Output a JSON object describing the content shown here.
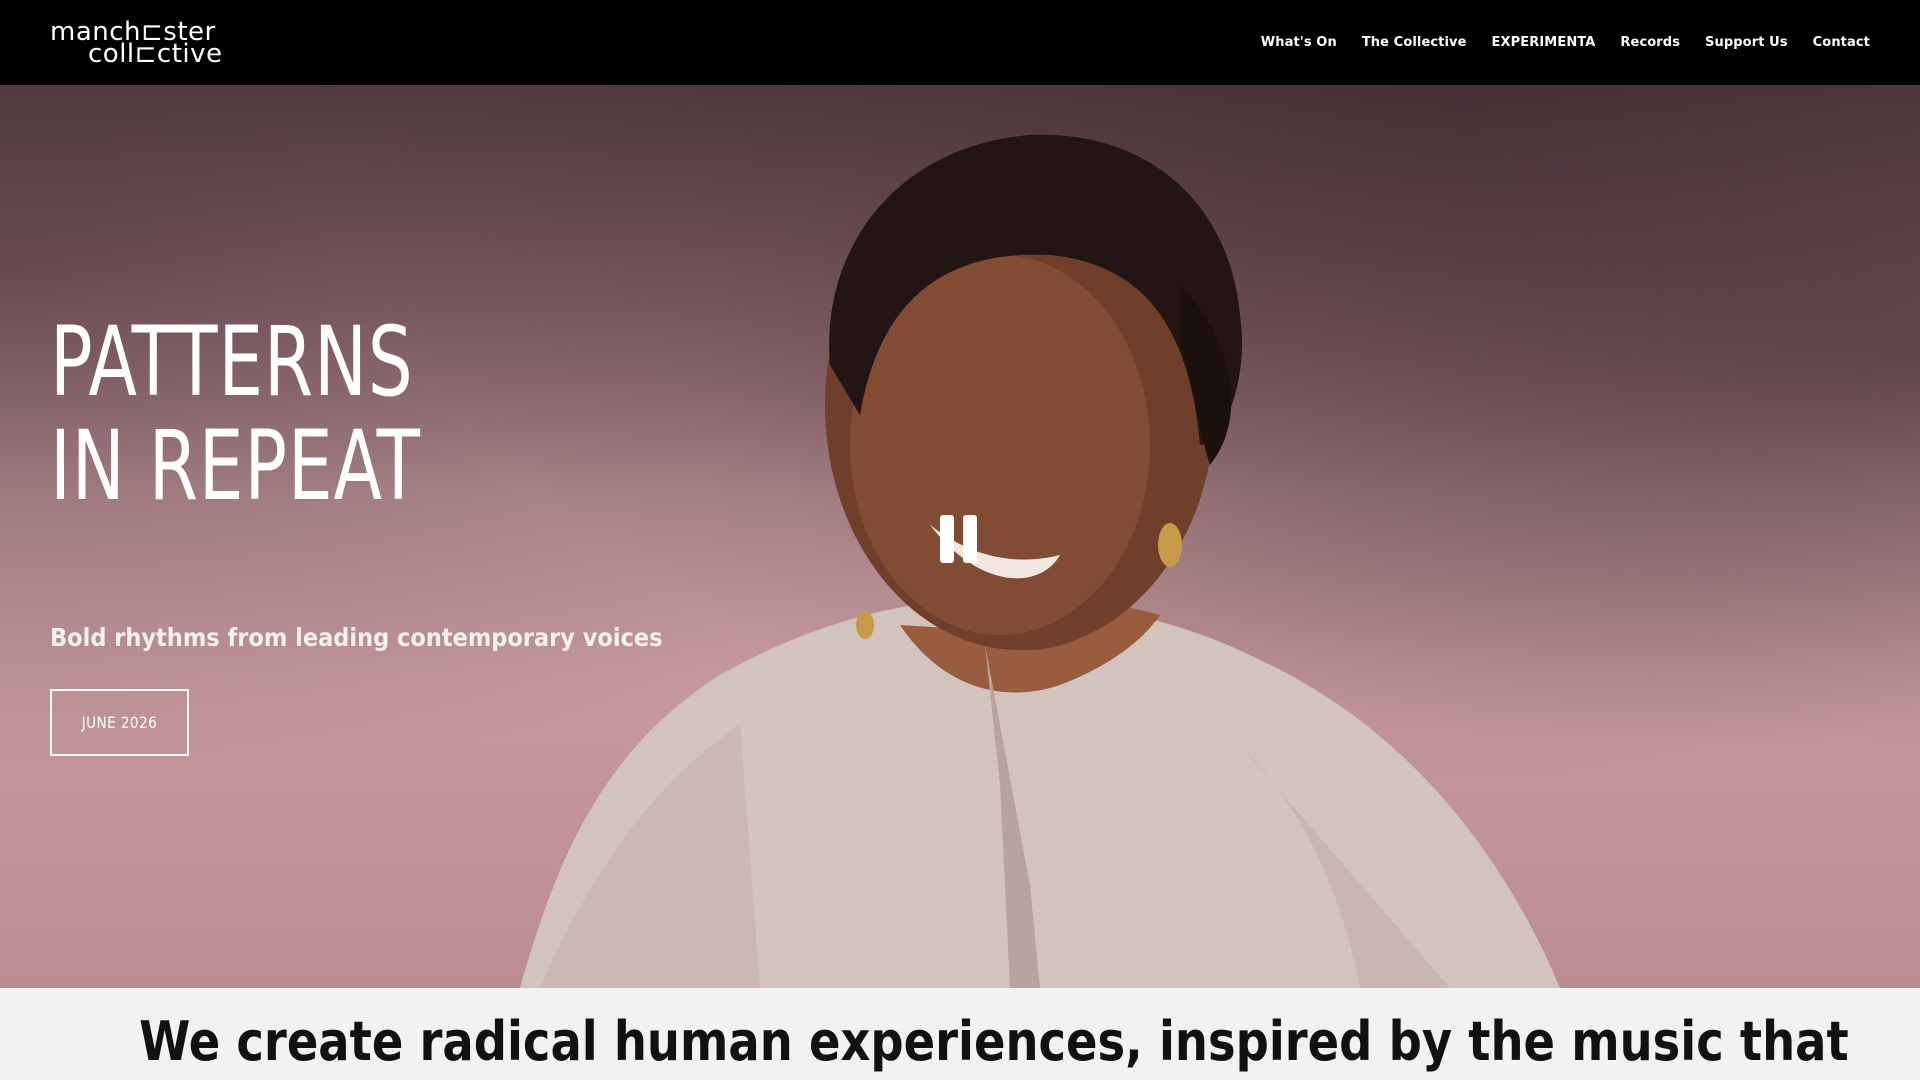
{
  "brand": {
    "logo_line1": "manch⊏ster",
    "logo_line2": "coll⊏ctive"
  },
  "nav": {
    "items": [
      {
        "label": "What's On"
      },
      {
        "label": "The Collective"
      },
      {
        "label": "EXPERIMENTA"
      },
      {
        "label": "Records"
      },
      {
        "label": "Support Us"
      },
      {
        "label": "Contact"
      }
    ]
  },
  "hero": {
    "title_line1": "PATTERNS",
    "title_line2": "IN REPEAT",
    "subtitle": "Bold rhythms from leading contemporary voices",
    "button_label": "JUNE 2026",
    "video_state": "playing",
    "control_icon": "pause-icon"
  },
  "intro": {
    "heading": "We create radical human experiences, inspired by the music that"
  },
  "colors": {
    "header_bg": "#000000",
    "hero_pink": "#c79a9f",
    "section_bg": "#f2f2f2",
    "text_dark": "#111111"
  }
}
